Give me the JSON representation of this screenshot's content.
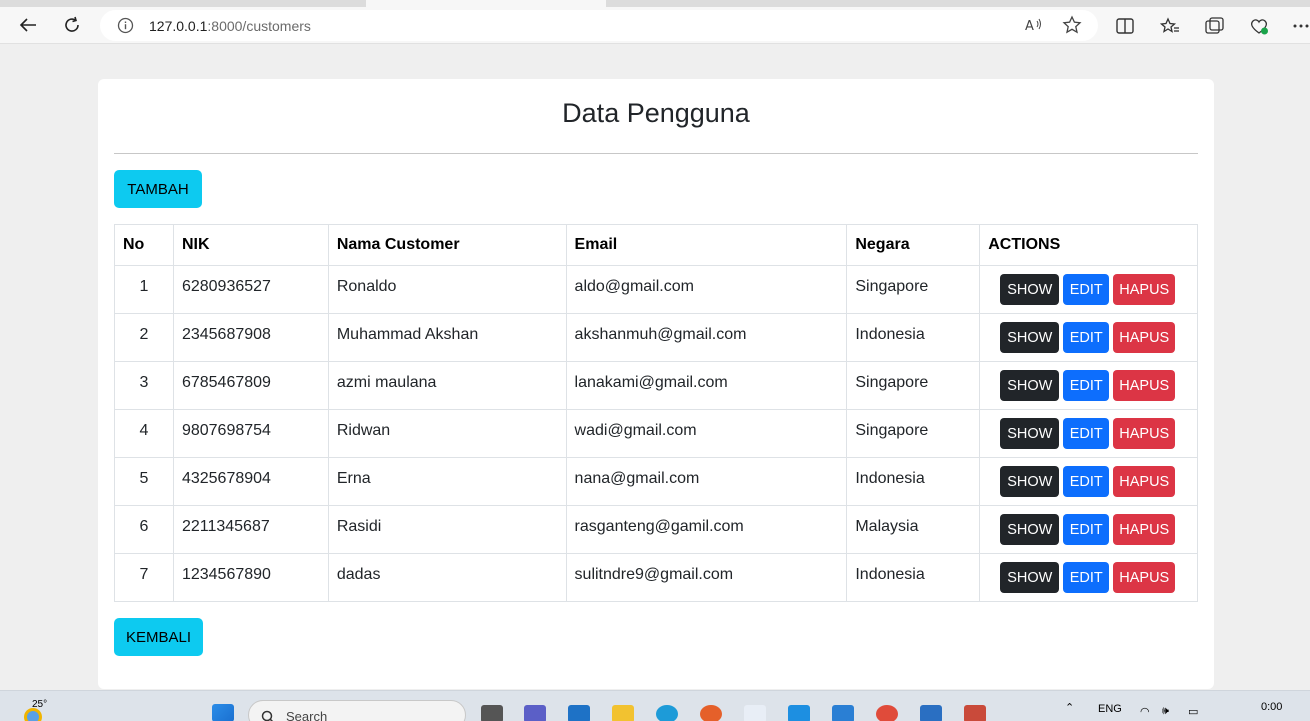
{
  "browser": {
    "url_host": "127.0.0.1",
    "url_path": ":8000/customers"
  },
  "page": {
    "title": "Data Pengguna",
    "add_button": "TAMBAH",
    "back_button": "KEMBALI",
    "columns": [
      "No",
      "NIK",
      "Nama Customer",
      "Email",
      "Negara",
      "ACTIONS"
    ],
    "rows": [
      {
        "no": "1",
        "nik": "6280936527",
        "nama": "Ronaldo",
        "email": "aldo@gmail.com",
        "negara": "Singapore"
      },
      {
        "no": "2",
        "nik": "2345687908",
        "nama": "Muhammad Akshan",
        "email": "akshanmuh@gmail.com",
        "negara": "Indonesia"
      },
      {
        "no": "3",
        "nik": "6785467809",
        "nama": "azmi maulana",
        "email": "lanakami@gmail.com",
        "negara": "Singapore"
      },
      {
        "no": "4",
        "nik": "9807698754",
        "nama": "Ridwan",
        "email": "wadi@gmail.com",
        "negara": "Singapore"
      },
      {
        "no": "5",
        "nik": "4325678904",
        "nama": "Erna",
        "email": "nana@gmail.com",
        "negara": "Indonesia"
      },
      {
        "no": "6",
        "nik": "2211345687",
        "nama": "Rasidi",
        "email": "rasganteng@gamil.com",
        "negara": "Malaysia"
      },
      {
        "no": "7",
        "nik": "1234567890",
        "nama": "dadas",
        "email": "sulitndre9@gmail.com",
        "negara": "Indonesia"
      }
    ],
    "action_labels": {
      "show": "SHOW",
      "edit": "EDIT",
      "delete": "HAPUS"
    },
    "colors": {
      "info": "#0dcaf0",
      "dark": "#212529",
      "primary": "#0d6efd",
      "danger": "#dc3545"
    }
  },
  "taskbar": {
    "temperature": "25°",
    "search_label": "Search",
    "language": "ENG",
    "time": "0:00"
  }
}
